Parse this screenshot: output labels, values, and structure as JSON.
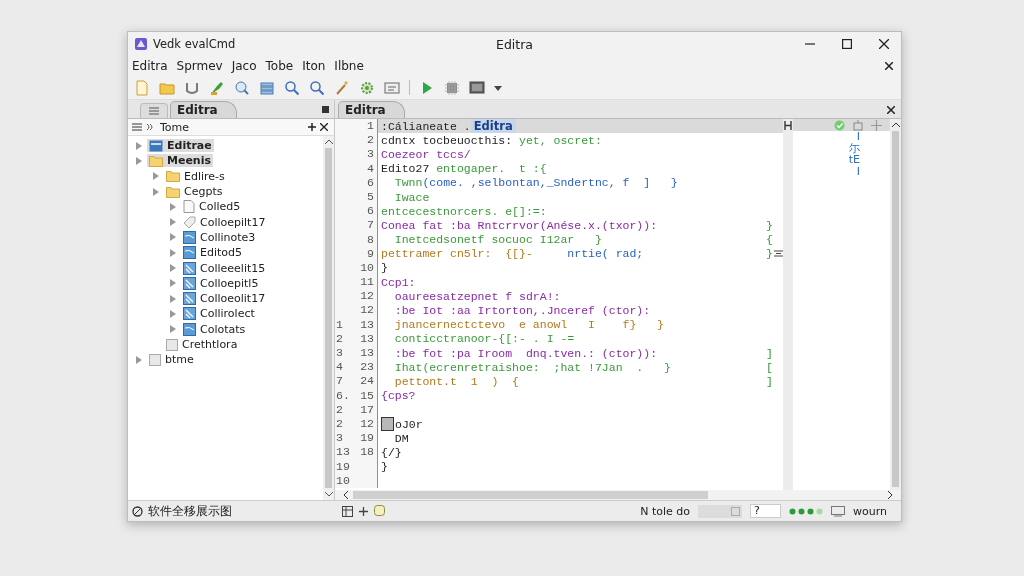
{
  "window": {
    "app_title": "Vedk evalCmd",
    "title": "Editra"
  },
  "menu": [
    "Editra",
    "Sprmev",
    "Jaco",
    "Tobe",
    "Iton",
    "Ilbne"
  ],
  "side_panel": {
    "tab": "Editra",
    "header": "Tome",
    "tree": [
      {
        "label": "Editrae",
        "kind": "project",
        "expandable": true,
        "selected": true
      },
      {
        "label": "Meenis",
        "kind": "folder",
        "expandable": true,
        "selected": true,
        "children": [
          {
            "label": "Edlire-s",
            "kind": "folder",
            "expandable": true,
            "selected": false
          },
          {
            "label": "Cegpts",
            "kind": "folder",
            "expandable": true,
            "selected": false,
            "children": [
              {
                "label": "Colled5",
                "kind": "file",
                "expandable": true,
                "selected": false
              },
              {
                "label": "Colloepilt17",
                "kind": "tag",
                "expandable": true,
                "selected": false
              },
              {
                "label": "Collinote3",
                "kind": "doc",
                "expandable": true,
                "selected": false
              },
              {
                "label": "Editod5",
                "kind": "doc",
                "expandable": true,
                "selected": false
              },
              {
                "label": "Colleeelit15",
                "kind": "script",
                "expandable": true,
                "selected": false
              },
              {
                "label": "Colloepitl5",
                "kind": "script",
                "expandable": true,
                "selected": false
              },
              {
                "label": "Colloeolit17",
                "kind": "script",
                "expandable": true,
                "selected": false
              },
              {
                "label": "Collirolect",
                "kind": "script",
                "expandable": true,
                "selected": false
              },
              {
                "label": "Colotats",
                "kind": "doc",
                "expandable": true,
                "selected": false
              }
            ]
          },
          {
            "label": "Crethtlora",
            "kind": "blank",
            "expandable": false,
            "selected": false
          }
        ]
      },
      {
        "label": "btme",
        "kind": "blank",
        "expandable": true,
        "selected": false
      }
    ]
  },
  "editor": {
    "tab": "Editra",
    "outline": [
      "I",
      "尓",
      "tE",
      "I"
    ],
    "lines": [
      {
        "number": "1",
        "segments": [
          {
            "text": ":Cálianeate .",
            "kind": "plain"
          },
          {
            "text": "Editra",
            "kind": "match"
          }
        ]
      },
      {
        "number": "2",
        "segments": [
          {
            "text": "cdntx tocbeuocthis: ",
            "kind": "plain"
          },
          {
            "text": "yet, oscret:",
            "kind": "string"
          }
        ]
      },
      {
        "number": "3",
        "segments": [
          {
            "text": "Coezeor tccs/",
            "kind": "keyword"
          }
        ]
      },
      {
        "number": "4",
        "segments": [
          {
            "text": "Edito27 ",
            "kind": "plain"
          },
          {
            "text": "entogaper.  t :{",
            "kind": "string"
          }
        ]
      },
      {
        "number": "6",
        "segments": [
          {
            "text": "  Twnn",
            "kind": "string"
          },
          {
            "text": "(come. ,selbontan,_Sndertnc, f  ]   }",
            "kind": "type"
          }
        ]
      },
      {
        "number": "5",
        "segments": [
          {
            "text": "  Iwace",
            "kind": "string"
          }
        ]
      },
      {
        "number": "6",
        "segments": [
          {
            "text": "entcecestnorcers. e[]:=:",
            "kind": "string"
          }
        ]
      },
      {
        "number": "7",
        "segments": [
          {
            "text": "Conea fat :ba Rntcrrvor(Anése.x.(txor)): ",
            "kind": "keyword"
          }
        ],
        "tail": "}"
      },
      {
        "number": "8",
        "segments": [
          {
            "text": "  Inetcedsonetf socuoc I12ar   }",
            "kind": "string"
          }
        ],
        "tail": "{"
      },
      {
        "number": "9",
        "segments": [
          {
            "text": "pettramer cn5lr:  {[}-     ",
            "kind": "number"
          },
          {
            "text": "nrtie( rad;",
            "kind": "type"
          }
        ],
        "tail": "}"
      },
      {
        "number": "10",
        "segments": [
          {
            "text": "}",
            "kind": "plain"
          }
        ]
      },
      {
        "number": "11",
        "segments": [
          {
            "text": "Ccp1:",
            "kind": "keyword"
          }
        ]
      },
      {
        "number": "12",
        "segments": [
          {
            "text": "  oaureesatzepnet f sdrA!:",
            "kind": "keyword"
          }
        ]
      },
      {
        "number": "12",
        "segments": [
          {
            "text": "  :be Iot :aa Irtorton,.Jnceref (ctor):",
            "kind": "keyword"
          }
        ]
      },
      {
        "outer": "1",
        "number": "13",
        "segments": [
          {
            "text": "  jnancernectctevo  e anowl   I    f}   }",
            "kind": "number"
          }
        ]
      },
      {
        "outer": "2",
        "number": "13",
        "segments": [
          {
            "text": "  conticctranoor-{[:- . I -=",
            "kind": "string"
          }
        ]
      },
      {
        "outer": "3",
        "number": "13",
        "segments": [
          {
            "text": "  :be fot :pa Iroom  dnq.tven.: (ctor)): ",
            "kind": "keyword"
          }
        ],
        "tail": "]"
      },
      {
        "outer": "4",
        "number": "23",
        "segments": [
          {
            "text": "  Ihat(ecrenretraishoe:  ;hat !7Jan  .   }",
            "kind": "string"
          }
        ],
        "tail": "["
      },
      {
        "outer": "7",
        "number": "24",
        "segments": [
          {
            "text": "  pettont.t  1  )  {",
            "kind": "number"
          }
        ],
        "tail": "]"
      },
      {
        "outer": "6.",
        "number": "15",
        "segments": [
          {
            "text": "{cps?",
            "kind": "keyword"
          }
        ]
      },
      {
        "outer": "2",
        "number": "17"
      },
      {
        "outer": "2",
        "number": "12",
        "segments": [
          {
            "kind": "bookmark"
          },
          {
            "text": "oJ0r",
            "kind": "plain"
          }
        ]
      },
      {
        "outer": "3",
        "number": "19",
        "segments": [
          {
            "text": "  DM",
            "kind": "plain"
          }
        ]
      },
      {
        "outer": "13",
        "number": "18",
        "segments": [
          {
            "text": "{/}",
            "kind": "plain"
          }
        ]
      },
      {
        "outer": "19",
        "segments": [
          {
            "text": "}",
            "kind": "plain"
          }
        ]
      },
      {
        "outer": "10"
      }
    ]
  },
  "status_bar": {
    "message": "软件全移展示图",
    "position": "N tole do",
    "mode": "?",
    "encoding": "wourn"
  }
}
